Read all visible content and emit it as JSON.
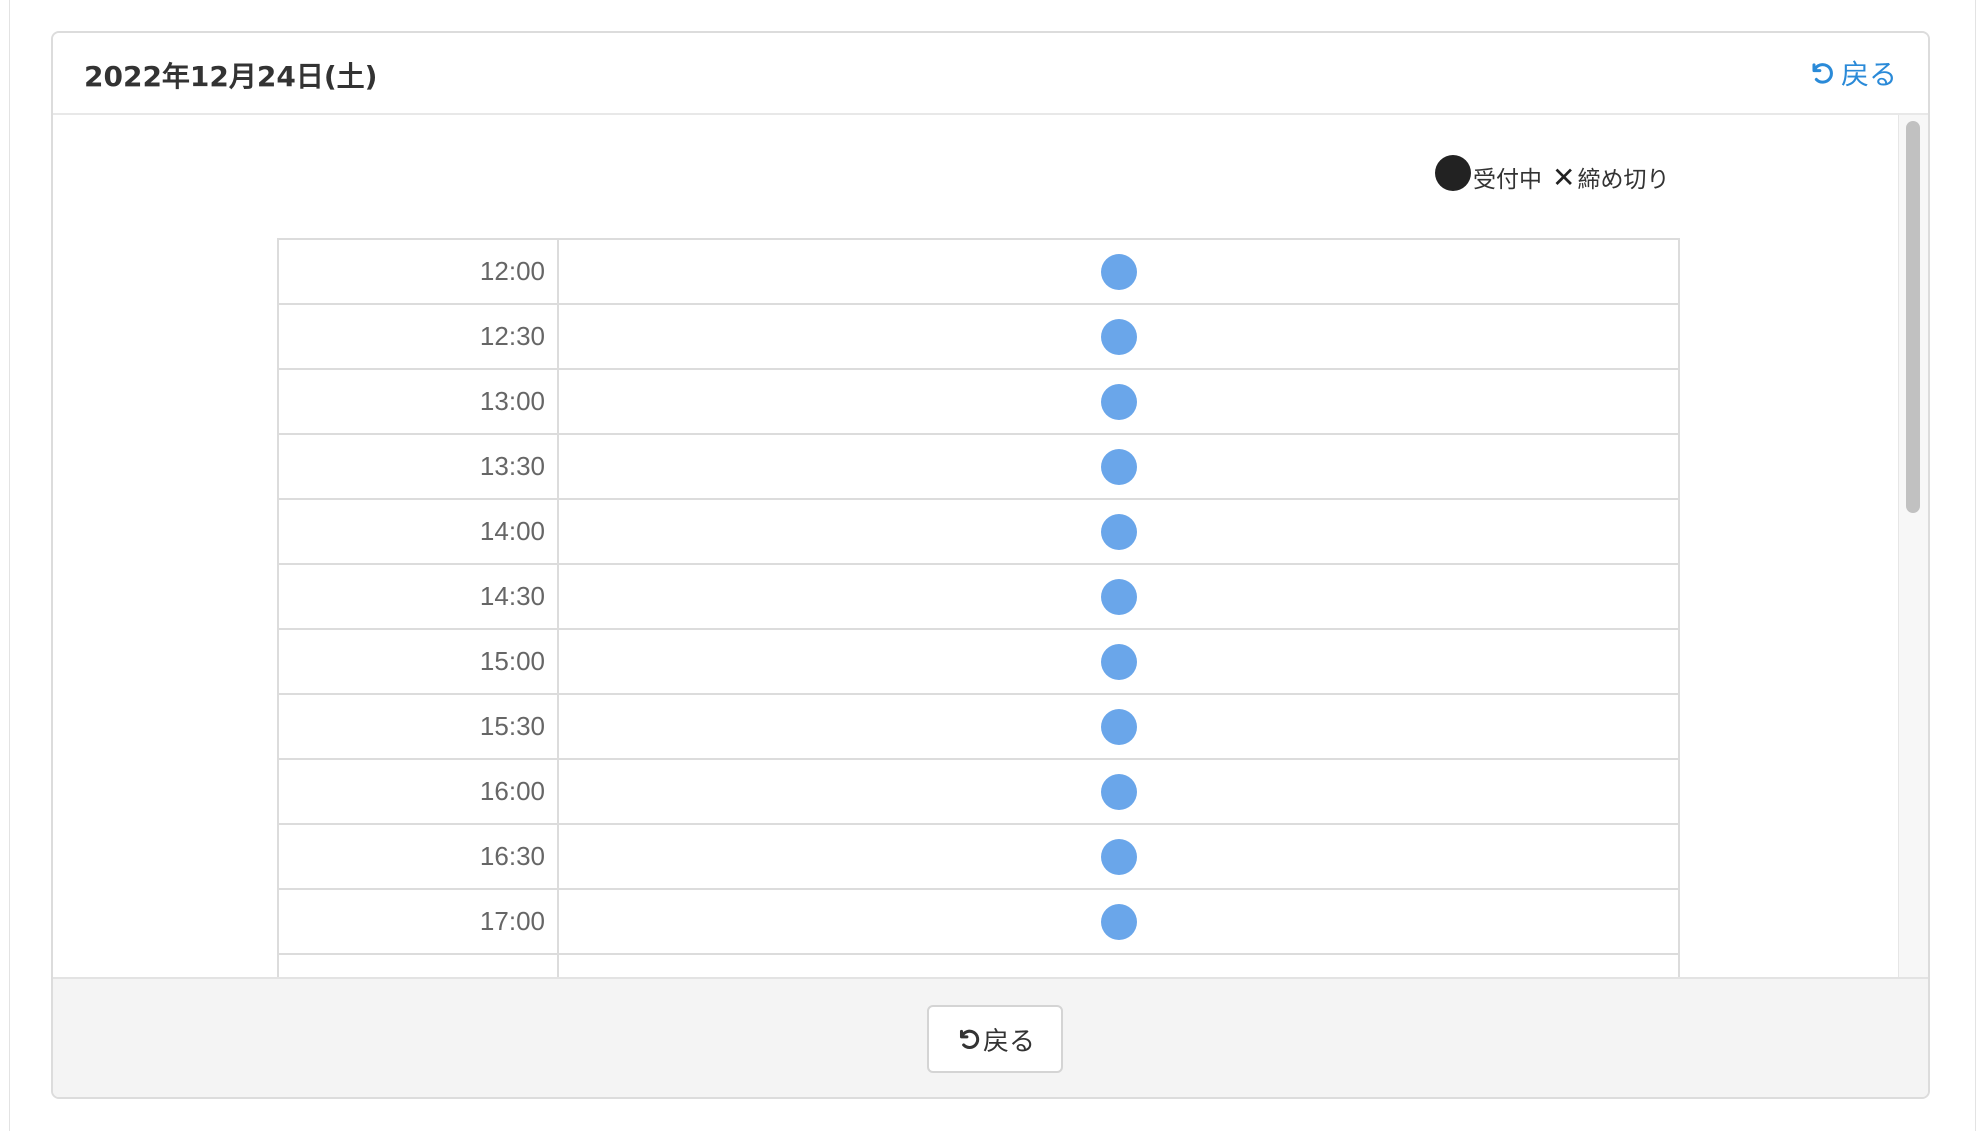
{
  "header": {
    "title": "2022年12月24日(土)",
    "back_label": "戻る"
  },
  "legend": {
    "open_label": "受付中",
    "closed_symbol": "✕",
    "closed_label": "締め切り"
  },
  "slots": [
    {
      "time": "12:00",
      "status": "open"
    },
    {
      "time": "12:30",
      "status": "open"
    },
    {
      "time": "13:00",
      "status": "open"
    },
    {
      "time": "13:30",
      "status": "open"
    },
    {
      "time": "14:00",
      "status": "open"
    },
    {
      "time": "14:30",
      "status": "open"
    },
    {
      "time": "15:00",
      "status": "open"
    },
    {
      "time": "15:30",
      "status": "open"
    },
    {
      "time": "16:00",
      "status": "open"
    },
    {
      "time": "16:30",
      "status": "open"
    },
    {
      "time": "17:00",
      "status": "open"
    }
  ],
  "footer": {
    "back_label": "戻る"
  },
  "colors": {
    "link": "#2a8ad8",
    "open_dot": "#6aa6ea",
    "legend_dot": "#222222"
  },
  "icons": {
    "back": "undo-icon"
  }
}
